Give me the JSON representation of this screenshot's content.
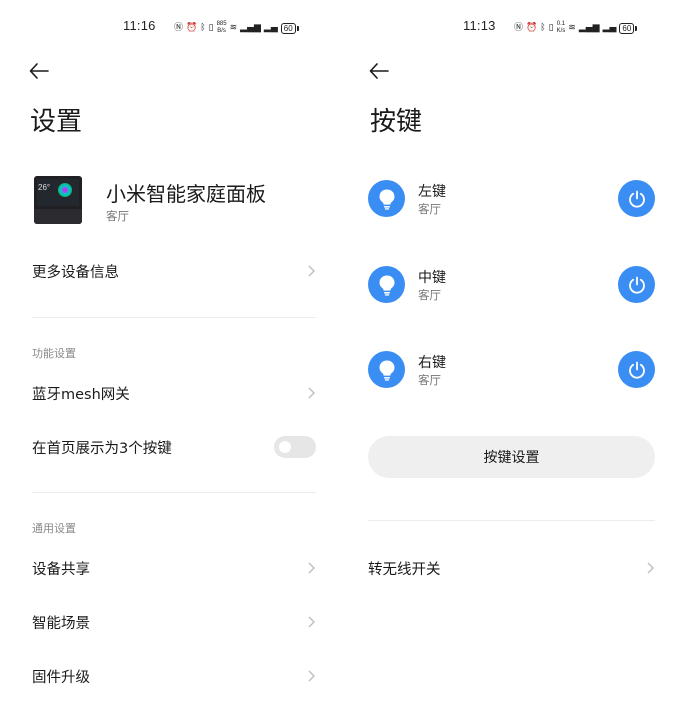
{
  "left": {
    "status": {
      "time": "11:16",
      "speed": "885\nB/s",
      "battery": "60"
    },
    "title": "设置",
    "device": {
      "name": "小米智能家庭面板",
      "room": "客厅",
      "thumb_temp": "26°"
    },
    "more_info": "更多设备信息",
    "section_function": "功能设置",
    "bluetooth_mesh": "蓝牙mesh网关",
    "show_three_keys": "在首页展示为3个按键",
    "show_three_keys_enabled": false,
    "section_general": "通用设置",
    "device_share": "设备共享",
    "smart_scene": "智能场景",
    "firmware_upgrade": "固件升级"
  },
  "right": {
    "status": {
      "time": "11:13",
      "speed": "0.1\nK/s",
      "battery": "60"
    },
    "title": "按键",
    "keys": [
      {
        "name": "左键",
        "room": "客厅"
      },
      {
        "name": "中键",
        "room": "客厅"
      },
      {
        "name": "右键",
        "room": "客厅"
      }
    ],
    "key_settings": "按键设置",
    "wireless_switch": "转无线开关"
  },
  "colors": {
    "accent": "#3a8ef3",
    "divider": "#ececec",
    "secondary_text": "#777777"
  },
  "icons": [
    "back-arrow-icon",
    "chevron-right-icon",
    "bulb-icon",
    "power-icon",
    "nfc-icon",
    "alarm-icon",
    "bluetooth-icon",
    "vibrate-icon",
    "wifi-icon",
    "signal-icon",
    "battery-icon"
  ]
}
